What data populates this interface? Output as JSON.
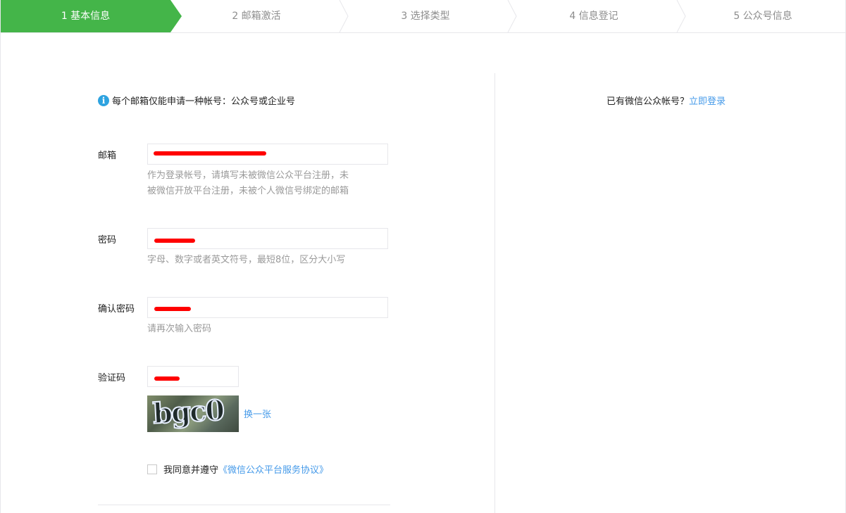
{
  "steps": [
    {
      "label": "1 基本信息",
      "active": true
    },
    {
      "label": "2 邮箱激活",
      "active": false
    },
    {
      "label": "3 选择类型",
      "active": false
    },
    {
      "label": "4 信息登记",
      "active": false
    },
    {
      "label": "5 公众号信息",
      "active": false
    }
  ],
  "notice": {
    "icon": "info-icon",
    "text": "每个邮箱仅能申请一种帐号：公众号或企业号"
  },
  "form": {
    "email": {
      "label": "邮箱",
      "value": "",
      "hint_line1": "作为登录帐号，请填写未被微信公众平台注册，未",
      "hint_line2": "被微信开放平台注册，未被个人微信号绑定的邮箱"
    },
    "password": {
      "label": "密码",
      "value": "",
      "hint": "字母、数字或者英文符号，最短8位，区分大小写"
    },
    "confirm_password": {
      "label": "确认密码",
      "value": "",
      "hint": "请再次输入密码"
    },
    "captcha": {
      "label": "验证码",
      "value": "",
      "image_text": "bgc0",
      "refresh_label": "换一张"
    },
    "agreement": {
      "prefix": "我同意并遵守",
      "link": "《微信公众平台服务协议》",
      "checked": false
    }
  },
  "sidebar": {
    "prompt": "已有微信公众帐号？",
    "login_link": "立即登录"
  },
  "colors": {
    "accent_green": "#44b549",
    "link_blue": "#459ae9",
    "redaction_red": "#ff0000",
    "info_blue": "#2ea3e0"
  }
}
